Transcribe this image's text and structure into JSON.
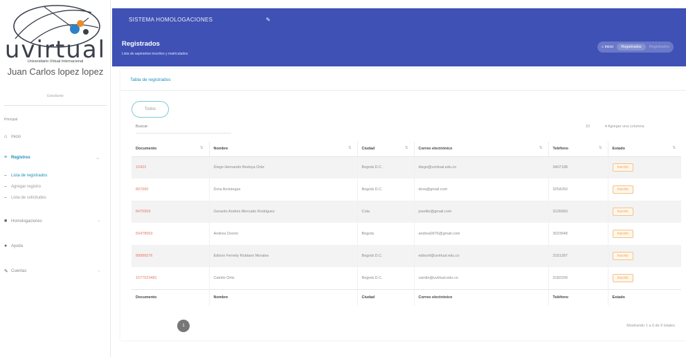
{
  "brand": {
    "logo_text": "uvirtual",
    "tagline": "Universitario Virtual Internacional",
    "colors": {
      "navy": "#3a3f4b",
      "accent_orange": "#f08a24",
      "accent_blue": "#2f80c8"
    }
  },
  "user": {
    "name": "Juan Carlos lopez lopez",
    "role": "Estudiante"
  },
  "sidebar": {
    "section_label": "Principal",
    "items": [
      {
        "label": "Inicio",
        "icon": "home-icon",
        "active": false,
        "has_arrow": false
      },
      {
        "label": "Registros",
        "icon": "list-icon",
        "active": true,
        "has_arrow": true
      },
      {
        "label": "Lista de registrados",
        "icon": "bullet-icon",
        "sub": true,
        "selected": true
      },
      {
        "label": "Agregar registro",
        "icon": "bullet-icon",
        "sub": true,
        "selected": false
      },
      {
        "label": "Lista de solicitudes",
        "icon": "bullet-icon",
        "sub": true,
        "selected": false
      },
      {
        "label": "Homologaciones",
        "icon": "briefcase-icon",
        "active": false,
        "has_arrow": true
      },
      {
        "label": "Ayuda",
        "icon": "help-icon",
        "active": false,
        "has_arrow": false
      },
      {
        "label": "Cuentas",
        "icon": "user-icon",
        "active": false,
        "has_arrow": true
      }
    ]
  },
  "topbar": {
    "title": "SISTEMA HOMOLOGACIONES",
    "pin_icon": "pin-icon",
    "heading": "Registrados",
    "subheading": "Lista de aspirantes inscritos y matriculados",
    "color": "#3f51b5",
    "breadcrumbs": {
      "home": "Inicio",
      "current": "Registrados",
      "last": "Registrados"
    }
  },
  "card": {
    "title": "Tabla de registrados",
    "todos_button": "Todos",
    "search_label": "Buscar:",
    "page_size": "10",
    "colvis_label": "Agregar una columna",
    "columns": [
      "Documento",
      "Nombre",
      "Ciudad",
      "Correo electrónico",
      "Teléfono",
      "Estado"
    ],
    "rows": [
      [
        "10422",
        "Diego Hernando Bedoya Ortiz",
        "Bogotá D.C.",
        "diego@uvirtual.edu.co",
        "3407198",
        "Inscrito"
      ],
      [
        "807060",
        "Dora Arciniegas",
        "Bogotá D.C.",
        "dora@gmail.com",
        "3254250",
        "Inscrito"
      ],
      [
        "8475559",
        "Gerardo Andrés Mercado Rodriguez",
        "Cota",
        "joselito@gmail.com",
        "3126650",
        "Inscrito"
      ],
      [
        "50478563",
        "Andrea Osorio",
        "Bogotá",
        "andrea0976@gmail.com",
        "3023648",
        "Inscrito"
      ],
      [
        "80896576",
        "Edison Fernely Rubiano Morales",
        "Bogotá D.C.",
        "edisonf@uvirtual.edu.co",
        "3151287",
        "Inscrito"
      ],
      [
        "1077523481",
        "Camilo Ortiz",
        "Bogotá D.C.",
        "camilo@uvirtual.edu.co",
        "3182209",
        "Inscrito"
      ]
    ],
    "pagination_current": "1",
    "info": "Mostrando 1 a 6 de 6 totales"
  }
}
